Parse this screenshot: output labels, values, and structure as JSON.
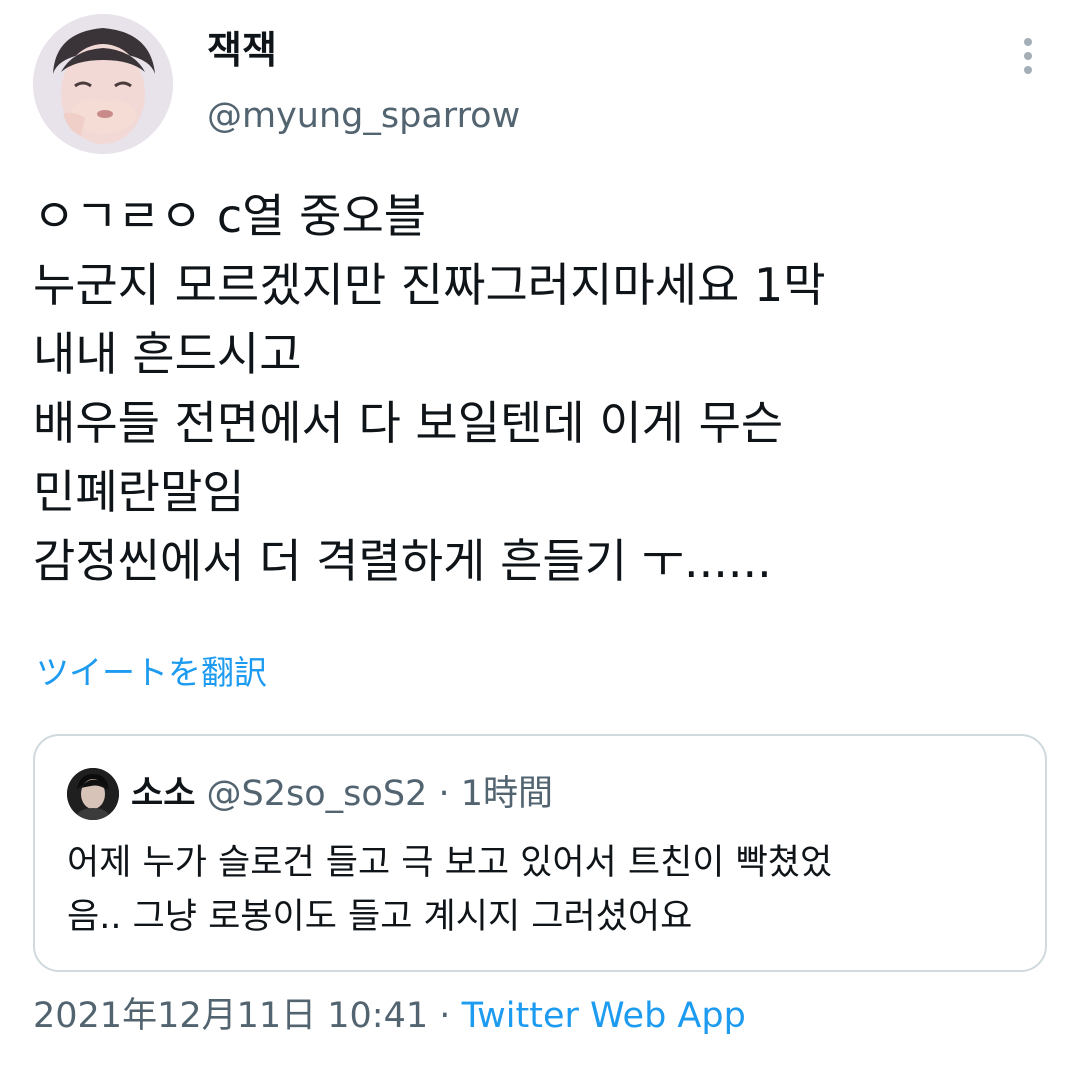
{
  "author": {
    "display_name": "잭잭",
    "handle": "@myung_sparrow",
    "avatar_icon": "profile-photo"
  },
  "more_icon": "more-vertical-icon",
  "tweet": {
    "lines": [
      "ㅇㄱㄹㅇ c열 중오블",
      "누군지 모르겠지만 진짜그러지마세요 1막",
      "내내 흔드시고",
      "배우들 전면에서 다 보일텐데 이게 무슨",
      "민폐란말임",
      "감정씬에서 더 격렬하게 흔들기 ㅜ......"
    ],
    "translate_label": "ツイートを翻訳"
  },
  "quote": {
    "display_name": "소소",
    "handle": "@S2so_soS2",
    "separator": "·",
    "time": "1時間",
    "lines": [
      "어제 누가 슬로건 들고 극 보고 있어서 트친이 빡쳤었",
      "음.. 그냥 로봉이도 들고 계시지 그러셨어요"
    ]
  },
  "footer": {
    "timestamp": "2021年12月11日 10:41",
    "separator": "·",
    "source": "Twitter Web App"
  },
  "colors": {
    "text": "#0f1419",
    "secondary": "#536471",
    "link": "#1d9bf0",
    "border": "#cfd9de"
  }
}
